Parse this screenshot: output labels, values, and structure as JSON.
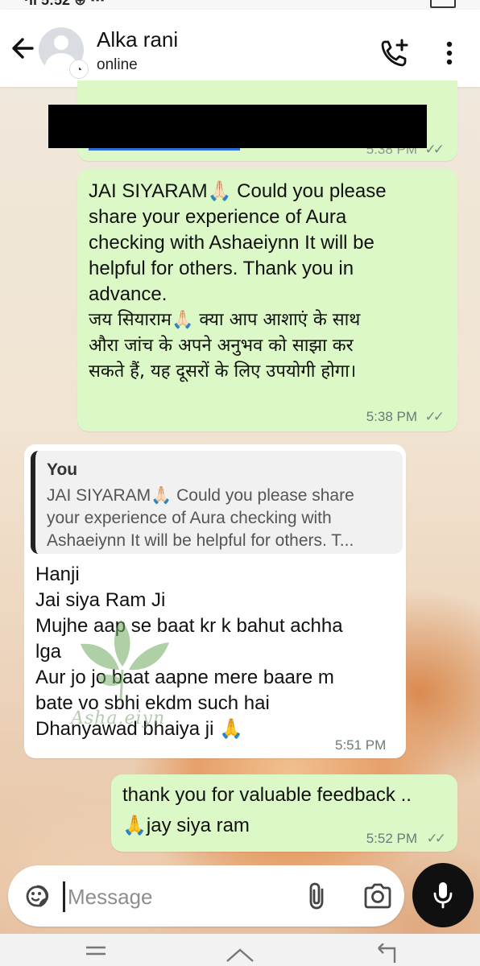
{
  "contact": {
    "name": "Alka rani",
    "status": "online"
  },
  "icons": {
    "back": "back-arrow-icon",
    "add_call": "add-call-icon",
    "menu": "more-vert-icon",
    "emoji": "sticker-icon",
    "attach": "attach-icon",
    "camera": "camera-icon",
    "mic": "mic-icon"
  },
  "messages": [
    {
      "id": "m0",
      "direction": "outgoing",
      "content": "[redacted]",
      "time": "5:38 PM",
      "status": "read"
    },
    {
      "id": "m1",
      "direction": "outgoing",
      "line1": "JAI SIYARAM🙏🏻 Could you please",
      "line2": "share your experience of Aura",
      "line3": "checking with Ashaeiynn It will be",
      "line4": "helpful for others. Thank you in",
      "line5": "advance.",
      "hindi1": "जय सियाराम🙏🏻  क्या आप आशाएं  के साथ",
      "hindi2": "औरा जांच के अपने अनुभव को साझा कर",
      "hindi3": "सकते हैं, यह दूसरों के लिए उपयोगी होगा।",
      "time": "5:38 PM",
      "status": "read"
    },
    {
      "id": "m2",
      "direction": "incoming",
      "reply_to": {
        "author": "You",
        "l1": "JAI SIYARAM🙏🏻 Could you please share",
        "l2": "your experience of Aura checking with",
        "l3": "Ashaeiynn It will be helpful for others. T..."
      },
      "line1": "Hanji",
      "line2": "Jai siya Ram Ji",
      "line3": "Mujhe aap se baat kr k bahut achha",
      "line4": "lga",
      "line5": "Aur jo jo baat aapne mere baare m",
      "line6": "bate vo sbhi ekdm such hai",
      "line7": "Dhanyawad bhaiya ji 🙏",
      "time": "5:51 PM"
    },
    {
      "id": "m3",
      "direction": "outgoing",
      "line1": "thank you for valuable feedback ..",
      "line2": "🙏jay siya ram",
      "time": "5:52 PM",
      "status": "read"
    }
  ],
  "watermark": "Asha.eiyn",
  "composer": {
    "placeholder": "Message"
  },
  "colors": {
    "outgoing_bubble": "#dcf8c6",
    "incoming_bubble": "#ffffff",
    "read_tick": "#7a8a80"
  }
}
